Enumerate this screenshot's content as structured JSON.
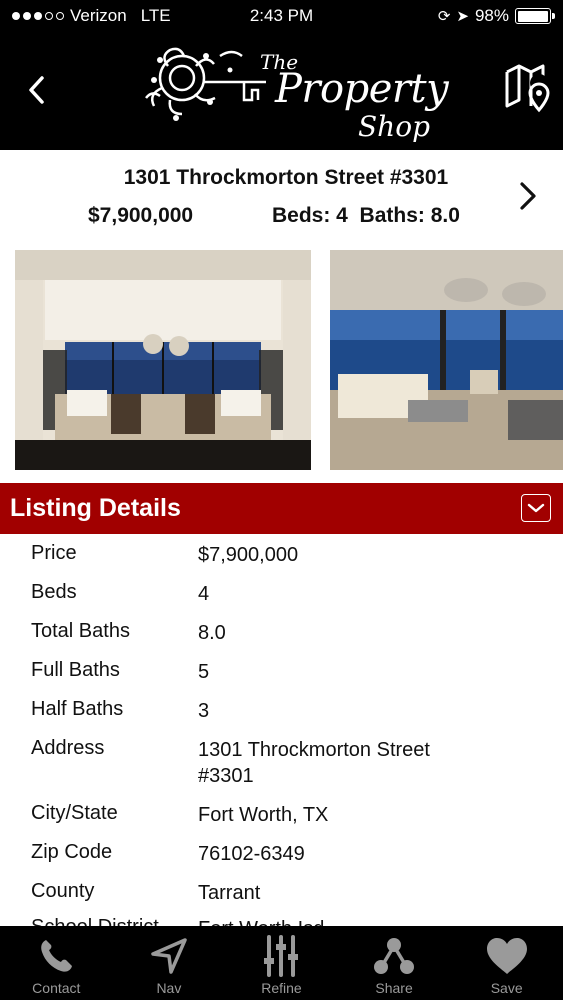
{
  "status": {
    "carrier": "Verizon",
    "network": "LTE",
    "time": "2:43 PM",
    "battery": "98%",
    "battery_fraction": 0.98
  },
  "header": {
    "logo": {
      "the": "The",
      "property": "Property",
      "shop": "Shop"
    }
  },
  "listing": {
    "address": "1301 Throckmorton Street #3301",
    "price": "$7,900,000",
    "beds_baths": "Beds: 4  Baths: 8.0"
  },
  "section": {
    "title": "Listing Details"
  },
  "details": [
    {
      "key": "Price",
      "value": "$7,900,000"
    },
    {
      "key": "Beds",
      "value": "4"
    },
    {
      "key": "Total Baths",
      "value": "8.0"
    },
    {
      "key": "Full Baths",
      "value": "5"
    },
    {
      "key": "Half Baths",
      "value": "3"
    },
    {
      "key": "Address",
      "value": "1301 Throckmorton Street #3301"
    },
    {
      "key": "City/State",
      "value": "Fort Worth, TX"
    },
    {
      "key": "Zip Code",
      "value": "76102-6349"
    },
    {
      "key": "County",
      "value": "Tarrant"
    },
    {
      "key": "School District",
      "value": "Fort Worth Isd"
    }
  ],
  "tabs": [
    {
      "label": "Contact",
      "icon": "phone-icon"
    },
    {
      "label": "Nav",
      "icon": "navigation-arrow-icon"
    },
    {
      "label": "Refine",
      "icon": "sliders-icon"
    },
    {
      "label": "Share",
      "icon": "share-icon"
    },
    {
      "label": "Save",
      "icon": "heart-icon"
    }
  ],
  "colors": {
    "accent": "#a10000",
    "header_bg": "#000000",
    "tab_icon": "#9a9a9a"
  }
}
